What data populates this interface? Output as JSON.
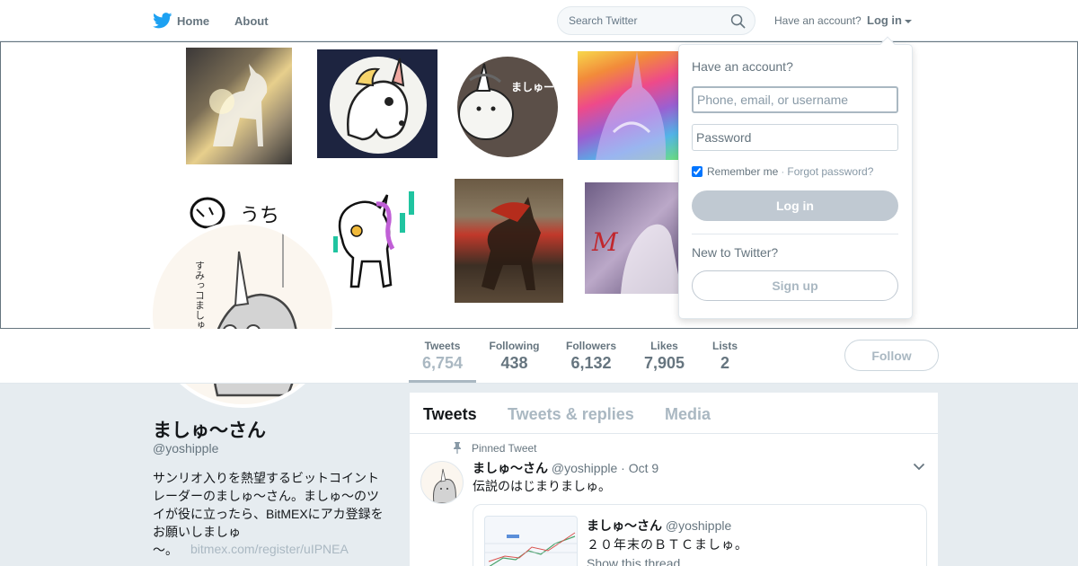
{
  "nav": {
    "home": "Home",
    "about": "About",
    "search_placeholder": "Search Twitter",
    "have_account": "Have an account?",
    "login": "Log in"
  },
  "login_dropdown": {
    "title": "Have an account?",
    "username_placeholder": "Phone, email, or username",
    "password_placeholder": "Password",
    "remember": "Remember me",
    "separator": "·",
    "forgot": "Forgot password?",
    "login_button": "Log in",
    "new_to_twitter": "New to Twitter?",
    "signup_button": "Sign up"
  },
  "header_art": {
    "tile3_text": "ましゅー",
    "tile5_text": "うち"
  },
  "avatar_text": "すみっコましゅー",
  "stats": [
    {
      "label": "Tweets",
      "value": "6,754"
    },
    {
      "label": "Following",
      "value": "438"
    },
    {
      "label": "Followers",
      "value": "6,132"
    },
    {
      "label": "Likes",
      "value": "7,905"
    },
    {
      "label": "Lists",
      "value": "2"
    }
  ],
  "follow_button": "Follow",
  "profile": {
    "name": "ましゅ～さん",
    "handle": "@yoshipple",
    "bio_lines": [
      "サンリオ入りを熱望するビットコイント",
      "レーダーのましゅ～さん。ましゅ～のツ",
      "イが役に立ったら、BitMEXにアカ登録を",
      "お願いしましゅ"
    ],
    "bio_end": "～。",
    "bio_link": "bitmex.com/register/uIPNEA"
  },
  "timeline": {
    "tabs": [
      "Tweets",
      "Tweets & replies",
      "Media"
    ],
    "pinned_label": "Pinned Tweet",
    "tweet": {
      "name": "ましゅ～さん",
      "handle": "@yoshipple",
      "dot": "·",
      "date": "Oct 9",
      "text": "伝説のはじまりましゅ。"
    },
    "quote": {
      "name": "ましゅ～さん",
      "handle": "@yoshipple",
      "text": "２０年末のＢＴＣましゅ。",
      "show_thread": "Show this thread"
    }
  },
  "colors": {
    "twitter_blue": "#1da1f2",
    "muted_text": "#66757f",
    "light_muted": "#aab8c2",
    "background": "#e6ecf0"
  },
  "icons": [
    "twitter-bird-icon",
    "search-icon",
    "caret-down-icon",
    "pin-icon",
    "chevron-down-icon"
  ]
}
